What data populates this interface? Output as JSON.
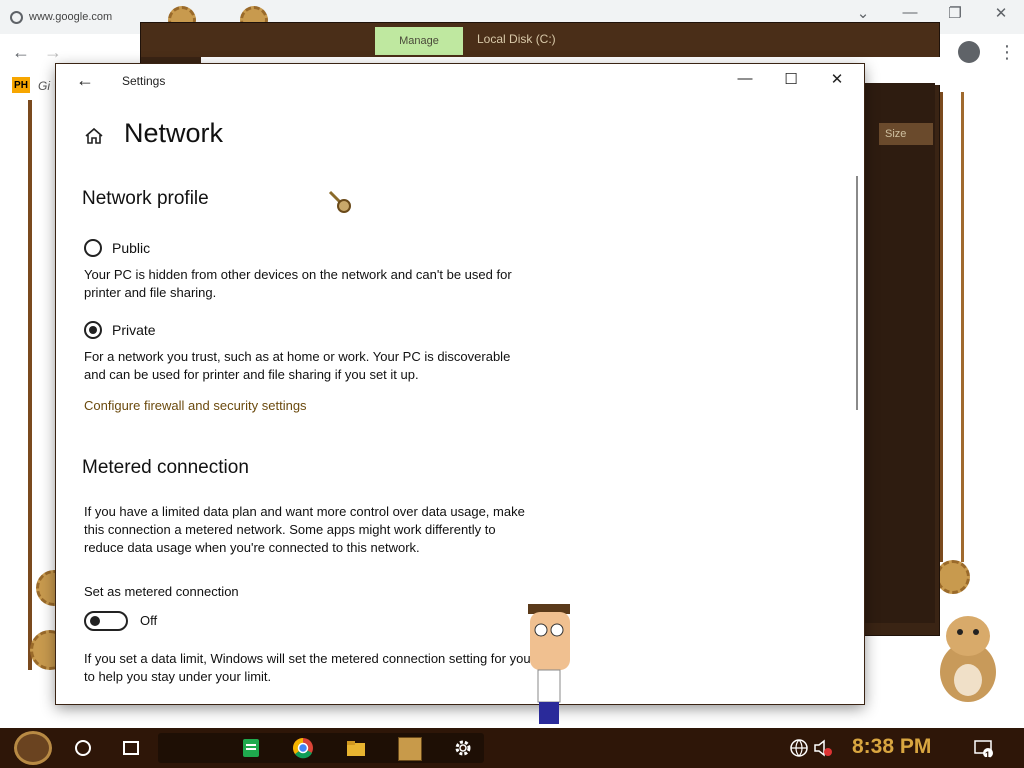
{
  "browser": {
    "tab_title": "www.google.com",
    "bookmark_badge": "PH",
    "bookmark_text": "Gi",
    "controls": {
      "minimize": "—",
      "restore": "❐",
      "close": "✕",
      "tab_dropdown": "⌄"
    },
    "nav": {
      "back": "←",
      "forward": "→",
      "menu": "⋮"
    }
  },
  "explorer": {
    "manage_tab": "Manage",
    "title": "Local Disk (C:)",
    "size_header": "Size"
  },
  "settings": {
    "window_title": "Settings",
    "back_label": "←",
    "controls": {
      "minimize": "—",
      "maximize": "☐",
      "close": "✕"
    },
    "page_title": "Network",
    "network_profile": {
      "heading": "Network profile",
      "options": [
        {
          "label": "Public",
          "selected": false,
          "description": "Your PC is hidden from other devices on the network and can't be used for printer and file sharing."
        },
        {
          "label": "Private",
          "selected": true,
          "description": "For a network you trust, such as at home or work. Your PC is discoverable and can be used for printer and file sharing if you set it up."
        }
      ],
      "link": "Configure firewall and security settings"
    },
    "metered": {
      "heading": "Metered connection",
      "intro": "If you have a limited data plan and want more control over data usage, make this connection a metered network. Some apps might work differently to reduce data usage when you're connected to this network.",
      "toggle_label": "Set as metered connection",
      "toggle_state": "Off",
      "limit_note": "If you set a data limit, Windows will set the metered connection setting for you to help you stay under your limit."
    }
  },
  "taskbar": {
    "clock": "8:38 PM",
    "notification_count": "1"
  },
  "colors": {
    "accent_link": "#6b4a0e",
    "taskbar_bg": "#2e1608",
    "clock_color": "#d9a640",
    "manage_tab_bg": "#bfe8a0"
  }
}
